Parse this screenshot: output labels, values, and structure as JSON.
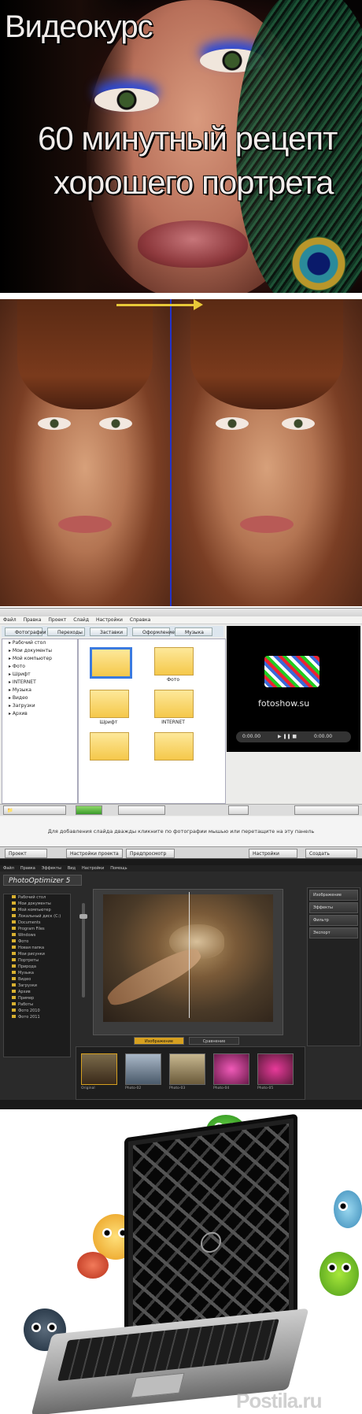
{
  "hero": {
    "line1": "Видеокурс",
    "line2": "60 минутный рецепт",
    "line3": "хорошего портрета"
  },
  "comparison": {
    "accent_arrow_color": "#e8c838",
    "divider_color": "#2233cc"
  },
  "slideshow_app": {
    "tabs": [
      "Фотографии",
      "Переходы",
      "Заставки",
      "Оформление",
      "Музыка"
    ],
    "preview_site": "fotoshow.su",
    "player_time_left": "0:00.00",
    "player_time_right": "0:00.00",
    "hint": "Для добавления слайда дважды кликните по фотографии мышью или перетащите на эту панель",
    "buttons": [
      "Проект",
      "Настройки проекта",
      "Предпросмотр",
      "Настройки",
      "Создать"
    ],
    "folder_captions": [
      "Фото",
      "Шрифт",
      "INTERNET"
    ]
  },
  "photo_optimizer": {
    "logo": "PhotoOptimizer 5",
    "tabs": [
      "Изображение",
      "Сравнение"
    ],
    "right_buttons": [
      "Изображение",
      "Эффекты",
      "Фильтр",
      "Экспорт"
    ],
    "thumb_captions": [
      "Original",
      "Photo-02",
      "Photo-03",
      "Photo-04",
      "Photo-05"
    ],
    "tree_items": [
      "Рабочий стол",
      "Мои документы",
      "Мой компьютер",
      "Локальный диск (C:)",
      "Documents",
      "Program Files",
      "Windows",
      "Фото",
      "Новая папка",
      "Мои рисунки",
      "Портреты",
      "Природа",
      "Музыка",
      "Видео",
      "Загрузки",
      "Архив",
      "Пример",
      "Работы",
      "Фото 2010",
      "Фото 2011"
    ]
  },
  "footer": {
    "watermark": "Postila.ru"
  }
}
